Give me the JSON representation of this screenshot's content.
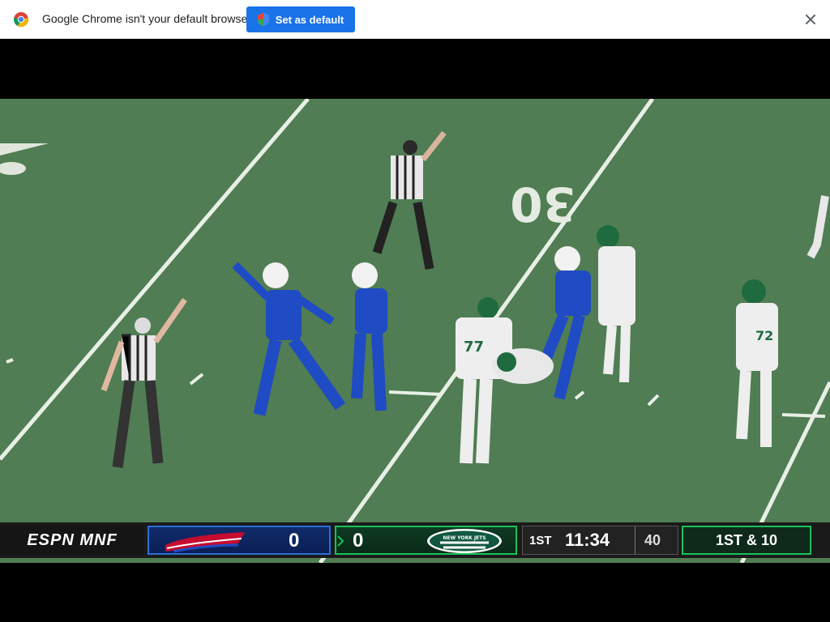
{
  "infobar": {
    "message": "Google Chrome isn't your default browser",
    "set_default_label": "Set as default",
    "icons": {
      "logo": "chrome-logo",
      "shield": "shield-icon",
      "close": "close-icon"
    }
  },
  "video": {
    "field_numbers": [
      "30"
    ],
    "scorebug": {
      "network_label": "ESPN MNF",
      "home_team": {
        "name": "Buffalo Bills",
        "score": "0",
        "logo_icon": "bills-logo"
      },
      "away_team": {
        "name": "New York Jets",
        "logo_text": "NEW YORK JETS",
        "score": "0",
        "logo_icon": "jets-logo"
      },
      "quarter": "1ST",
      "game_clock": "11:34",
      "play_clock": "40",
      "down_distance": "1ST & 10"
    }
  },
  "colors": {
    "primary_button": "#1a73e8",
    "field_green": "#4e7a52",
    "bills_blue": "#1f3f9c",
    "jets_green": "#16c35a"
  }
}
